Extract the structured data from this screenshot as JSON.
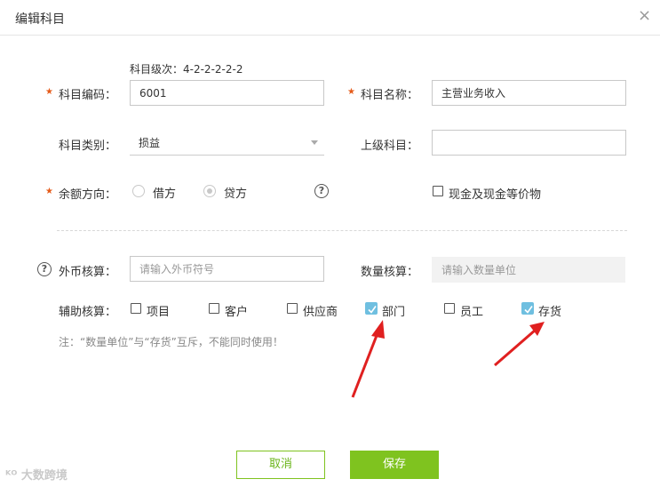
{
  "dialog": {
    "title": "编辑科目",
    "close_glyph": "×"
  },
  "form": {
    "level_hint": "科目级次：4-2-2-2-2-2",
    "required_mark": "★",
    "code": {
      "label": "科目编码：",
      "value": "6001"
    },
    "name": {
      "label": "科目名称：",
      "value": "主营业务收入"
    },
    "category": {
      "label": "科目类别：",
      "value": "损益"
    },
    "parent": {
      "label": "上级科目：",
      "value": ""
    },
    "balance_direction": {
      "label": "余额方向：",
      "options": [
        {
          "label": "借方",
          "checked": false
        },
        {
          "label": "贷方",
          "checked": true
        }
      ]
    },
    "help_glyph": "?",
    "cash_equivalent": {
      "label": "现金及现金等价物",
      "checked": false
    },
    "foreign_currency": {
      "label": "外币核算：",
      "placeholder": "请输入外币符号"
    },
    "quantity": {
      "label": "数量核算：",
      "placeholder": "请输入数量单位"
    },
    "auxiliary": {
      "label": "辅助核算：",
      "items": [
        {
          "label": "项目",
          "checked": false
        },
        {
          "label": "客户",
          "checked": false
        },
        {
          "label": "供应商",
          "checked": false
        },
        {
          "label": "部门",
          "checked": true
        },
        {
          "label": "员工",
          "checked": false
        },
        {
          "label": "存货",
          "checked": true
        }
      ]
    },
    "note": "注：“数量单位”与“存货”互斥，不能同时使用！"
  },
  "buttons": {
    "cancel": "取消",
    "save": "保存"
  },
  "watermark": "大数跨境",
  "colors": {
    "accent_green": "#7fc31f",
    "required_star": "#e55b1a",
    "checkbox_checked": "#6fbfe0",
    "arrow_red": "#e02020"
  }
}
